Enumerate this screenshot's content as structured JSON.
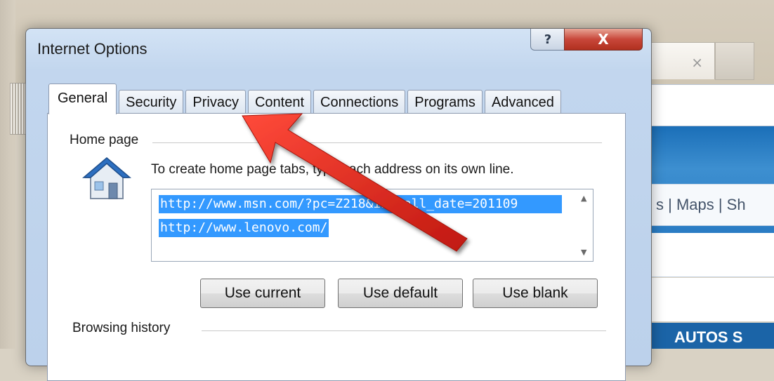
{
  "background": {
    "tab_close": "×",
    "nav_links": "s | Maps | Sh",
    "bottom_nav": "AUTOS   S"
  },
  "dialog": {
    "title": "Internet Options",
    "help_button": "?",
    "close_button": "X",
    "tabs": [
      {
        "label": "General",
        "active": true
      },
      {
        "label": "Security",
        "active": false
      },
      {
        "label": "Privacy",
        "active": false
      },
      {
        "label": "Content",
        "active": false
      },
      {
        "label": "Connections",
        "active": false
      },
      {
        "label": "Programs",
        "active": false
      },
      {
        "label": "Advanced",
        "active": false
      }
    ],
    "home_page": {
      "section_label": "Home page",
      "instructions": "To create home page tabs, type each address on its own line.",
      "urls": [
        "http://www.msn.com/?pc=Z218&install_date=201109",
        "http://www.lenovo.com/"
      ],
      "buttons": {
        "use_current": "Use current",
        "use_default": "Use default",
        "use_blank": "Use blank"
      }
    },
    "browsing_history": {
      "section_label": "Browsing history"
    }
  },
  "annotation": {
    "arrow_color": "#e0261c",
    "points_to": "Privacy"
  }
}
